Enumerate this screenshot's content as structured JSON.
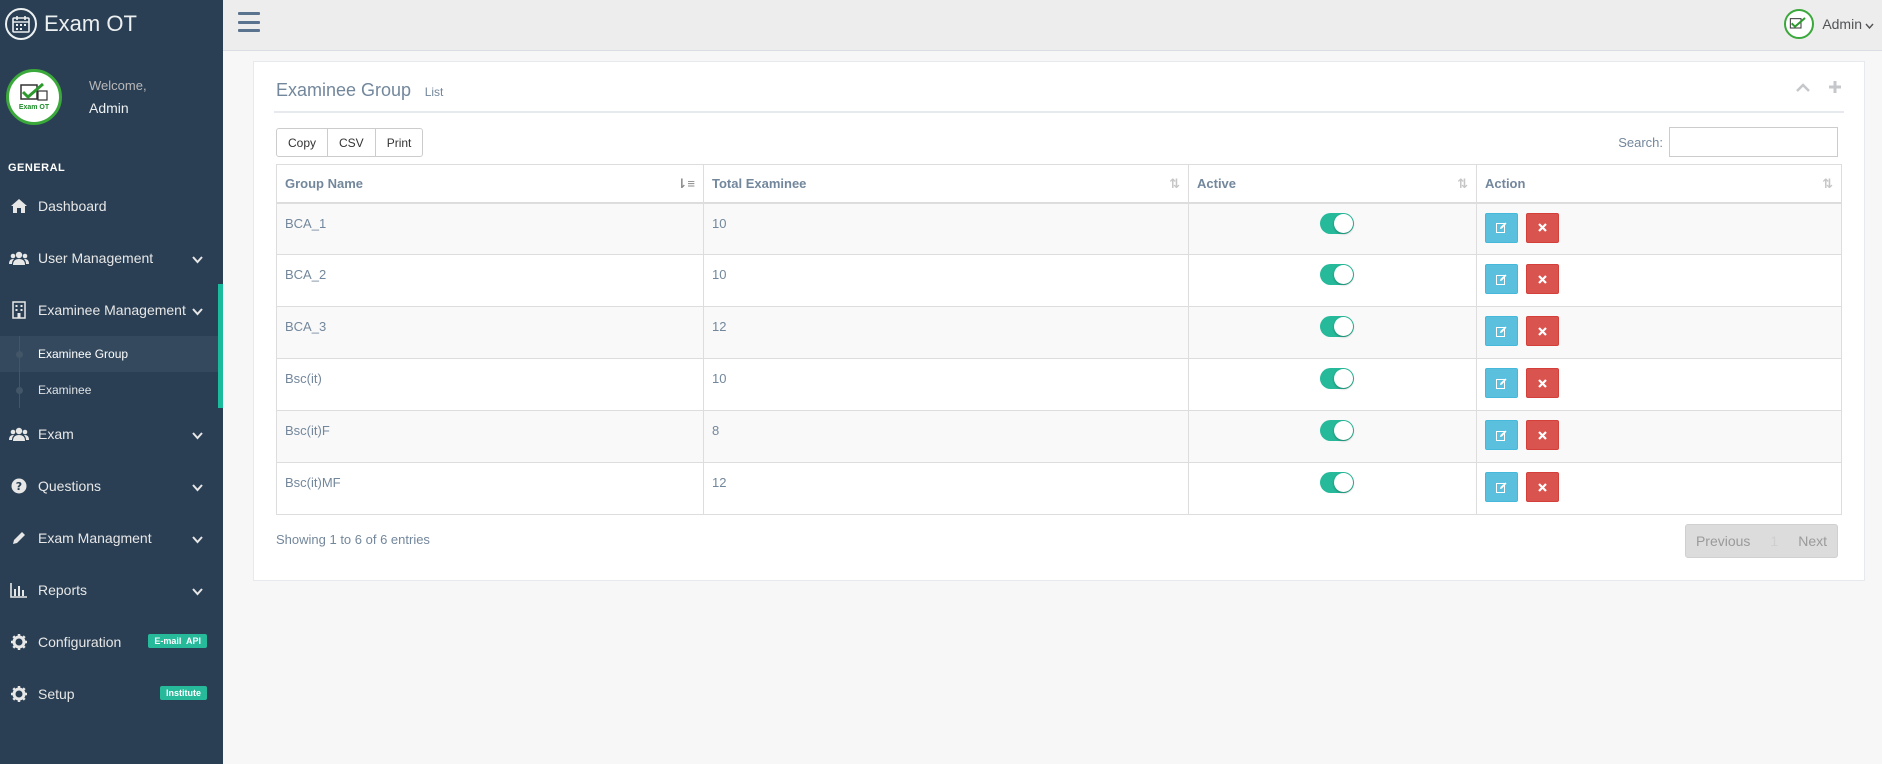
{
  "app": {
    "title": "Exam OT"
  },
  "profile": {
    "welcome": "Welcome,",
    "name": "Admin",
    "logo_text": "Exam OT"
  },
  "sidebar": {
    "section": "GENERAL",
    "items": [
      {
        "label": "Dashboard",
        "icon": "home-icon"
      },
      {
        "label": "User Management",
        "icon": "users-icon"
      },
      {
        "label": "Examinee Management",
        "icon": "building-icon"
      },
      {
        "label": "Exam",
        "icon": "users-icon"
      },
      {
        "label": "Questions",
        "icon": "question-icon"
      },
      {
        "label": "Exam Managment",
        "icon": "pencil-icon"
      },
      {
        "label": "Reports",
        "icon": "bar-chart-icon"
      },
      {
        "label": "Configuration",
        "icon": "gear-icon",
        "badge": "E-mail  API"
      },
      {
        "label": "Setup",
        "icon": "gear-icon",
        "badge": "Institute"
      }
    ],
    "submenu": [
      {
        "label": "Examinee Group"
      },
      {
        "label": "Examinee"
      }
    ]
  },
  "topnav": {
    "user": "Admin"
  },
  "panel": {
    "title": "Examinee Group",
    "subtitle": "List",
    "buttons": {
      "copy": "Copy",
      "csv": "CSV",
      "print": "Print"
    },
    "search_label": "Search:",
    "search_value": ""
  },
  "table": {
    "headers": [
      "Group Name",
      "Total Examinee",
      "Active",
      "Action"
    ],
    "rows": [
      {
        "name": "BCA_1",
        "total": "10"
      },
      {
        "name": "BCA_2",
        "total": "10"
      },
      {
        "name": "BCA_3",
        "total": "12"
      },
      {
        "name": "Bsc(it)",
        "total": "10"
      },
      {
        "name": "Bsc(it)F",
        "total": "8"
      },
      {
        "name": "Bsc(it)MF",
        "total": "12"
      }
    ]
  },
  "footer": {
    "info": "Showing 1 to 6 of 6 entries",
    "previous": "Previous",
    "page": "1",
    "next": "Next"
  },
  "colors": {
    "sidebar": "#2a3f54",
    "accent": "#1abb9c",
    "toggle": "#26b99a",
    "edit": "#5bc0de",
    "delete": "#d9534f"
  }
}
